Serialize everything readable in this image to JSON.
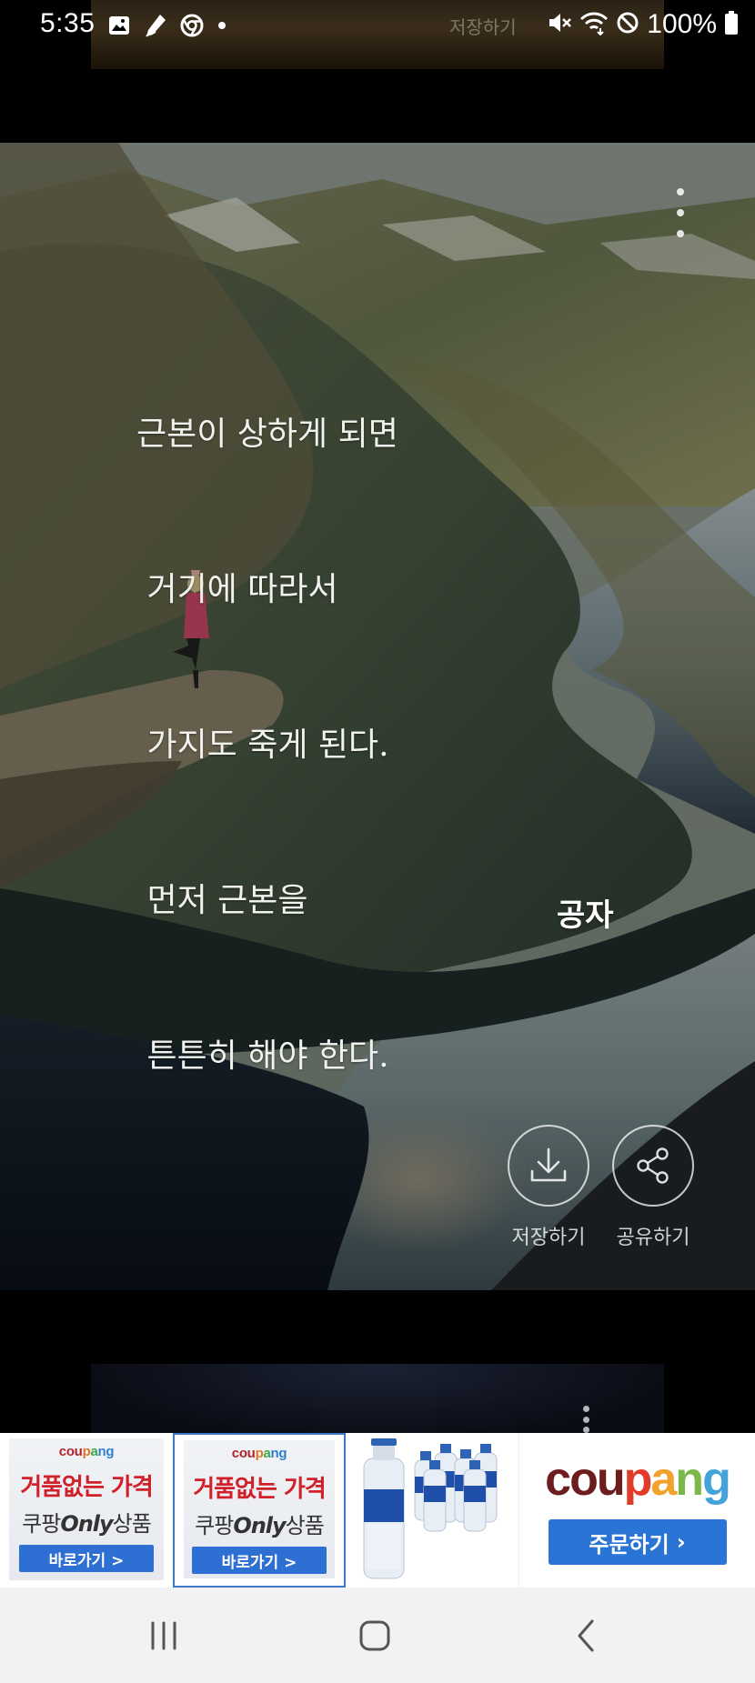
{
  "status_bar": {
    "time": "5:35",
    "ghost_text": "저장하기",
    "battery": "100%"
  },
  "card": {
    "quote_lines": [
      "근본이 상하게 되면",
      " 거기에 따라서",
      " 가지도 죽게 된다.",
      " 먼저 근본을",
      " 튼튼히 해야 한다."
    ],
    "author": "공자",
    "actions": {
      "save_label": "저장하기",
      "share_label": "공유하기"
    }
  },
  "ad": {
    "promo_logo": [
      "cou",
      "p",
      "a",
      "ng"
    ],
    "promo_tiles": [
      {
        "headline": "거품없는 가격",
        "sub_prefix": "쿠팡",
        "sub_only": "Only",
        "sub_suffix": "상품",
        "cta": "바로가기 >"
      },
      {
        "headline": "거품없는 가격",
        "sub_prefix": "쿠팡",
        "sub_only": "Only",
        "sub_suffix": "상품",
        "cta": "바로가기 >"
      }
    ],
    "brand_logo": [
      "cou",
      "p",
      "a",
      "n",
      "g"
    ],
    "brand_cta": "주문하기",
    "brand_cta_arrow": "›"
  },
  "colors": {
    "brand_blue": "#2974d5",
    "promo_red": "#d0202a",
    "selected_border": "#3a78c8"
  }
}
